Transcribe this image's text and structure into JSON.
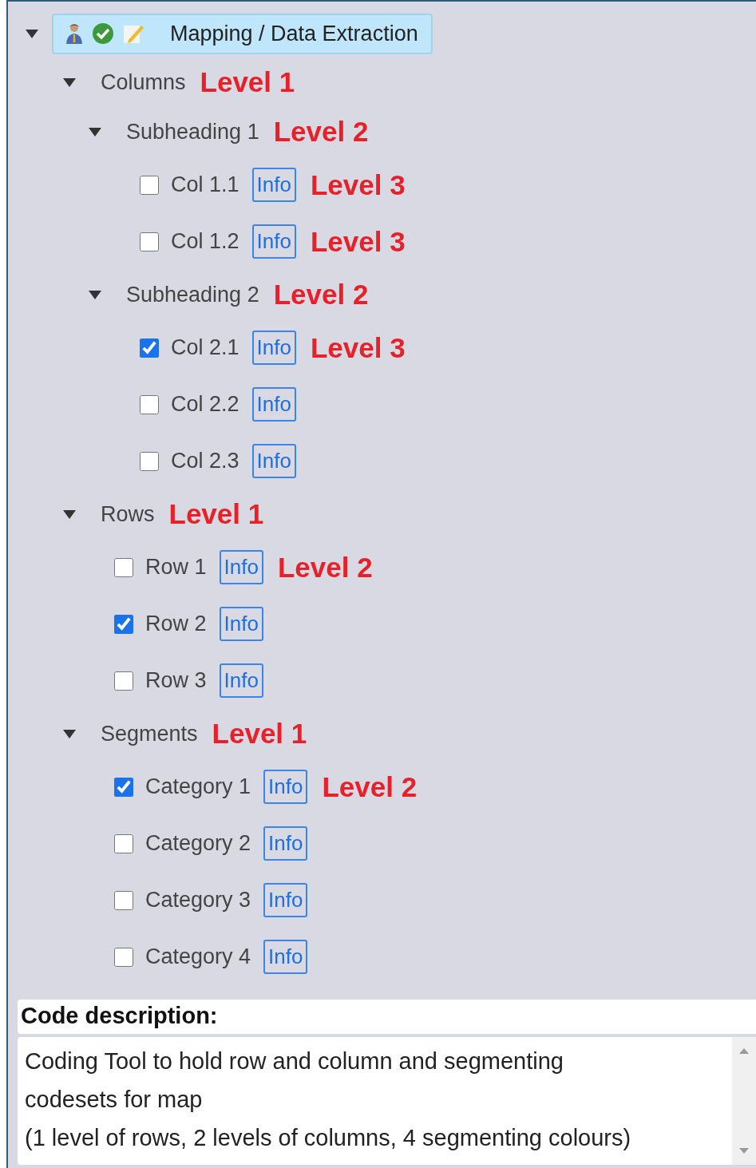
{
  "tree": {
    "label": "Mapping / Data Extraction",
    "expanded": true,
    "selected": true,
    "children": [
      {
        "kind": "group",
        "label": "Columns",
        "note": "Level 1",
        "expanded": true,
        "children": [
          {
            "kind": "group",
            "label": "Subheading 1",
            "note": "Level 2",
            "expanded": true,
            "children": [
              {
                "kind": "code",
                "label": "Col 1.1",
                "checked": false,
                "info": "Info",
                "note": "Level 3"
              },
              {
                "kind": "code",
                "label": "Col 1.2",
                "checked": false,
                "info": "Info",
                "note": "Level 3"
              }
            ]
          },
          {
            "kind": "group",
            "label": "Subheading 2",
            "note": "Level 2",
            "expanded": true,
            "children": [
              {
                "kind": "code",
                "label": "Col 2.1",
                "checked": true,
                "info": "Info",
                "note": "Level 3"
              },
              {
                "kind": "code",
                "label": "Col 2.2",
                "checked": false,
                "info": "Info"
              },
              {
                "kind": "code",
                "label": "Col 2.3",
                "checked": false,
                "info": "Info"
              }
            ]
          }
        ]
      },
      {
        "kind": "group",
        "label": "Rows",
        "note": "Level 1",
        "expanded": true,
        "children": [
          {
            "kind": "code",
            "label": "Row 1",
            "checked": false,
            "info": "Info",
            "note": "Level 2"
          },
          {
            "kind": "code",
            "label": "Row 2",
            "checked": true,
            "info": "Info"
          },
          {
            "kind": "code",
            "label": "Row 3",
            "checked": false,
            "info": "Info"
          }
        ]
      },
      {
        "kind": "group",
        "label": "Segments",
        "note": "Level 1",
        "expanded": true,
        "children": [
          {
            "kind": "code",
            "label": "Category 1",
            "checked": true,
            "info": "Info",
            "note": "Level 2"
          },
          {
            "kind": "code",
            "label": "Category 2",
            "checked": false,
            "info": "Info"
          },
          {
            "kind": "code",
            "label": "Category 3",
            "checked": false,
            "info": "Info"
          },
          {
            "kind": "code",
            "label": "Category 4",
            "checked": false,
            "info": "Info"
          }
        ]
      }
    ]
  },
  "description": {
    "label": "Code description:",
    "lines": [
      "Coding Tool to hold row and column and segmenting",
      "codesets for map",
      "(1 level of rows, 2 levels of columns, 4 segmenting colours)"
    ]
  }
}
